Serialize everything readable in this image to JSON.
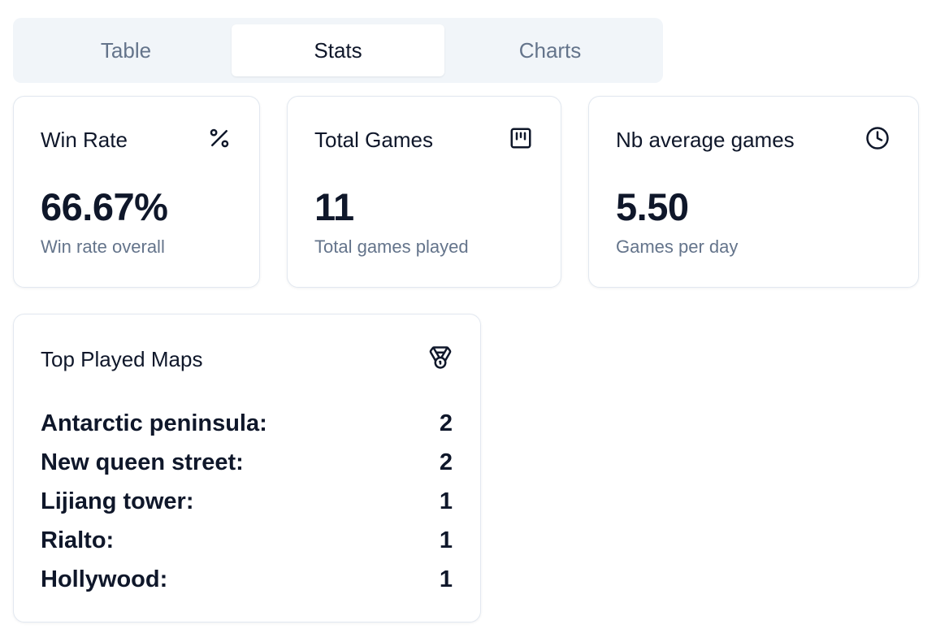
{
  "tabs": [
    {
      "label": "Table",
      "active": false
    },
    {
      "label": "Stats",
      "active": true
    },
    {
      "label": "Charts",
      "active": false
    }
  ],
  "cards": {
    "win_rate": {
      "title": "Win Rate",
      "icon": "percent-icon",
      "value": "66.67%",
      "subtitle": "Win rate overall"
    },
    "total_games": {
      "title": "Total Games",
      "icon": "board-icon",
      "value": "11",
      "subtitle": "Total games played"
    },
    "avg_games": {
      "title": "Nb average games",
      "icon": "clock-icon",
      "value": "5.50",
      "subtitle": "Games per day"
    }
  },
  "top_maps": {
    "title": "Top Played Maps",
    "icon": "medal-icon",
    "items": [
      {
        "name": "Antarctic peninsula:",
        "count": "2"
      },
      {
        "name": "New queen street:",
        "count": "2"
      },
      {
        "name": "Lijiang tower:",
        "count": "1"
      },
      {
        "name": "Rialto:",
        "count": "1"
      },
      {
        "name": "Hollywood:",
        "count": "1"
      }
    ]
  },
  "colors": {
    "text": "#0f172a",
    "muted": "#64748b",
    "tab_bg": "#f1f5f9",
    "border": "#e2e8f0"
  }
}
